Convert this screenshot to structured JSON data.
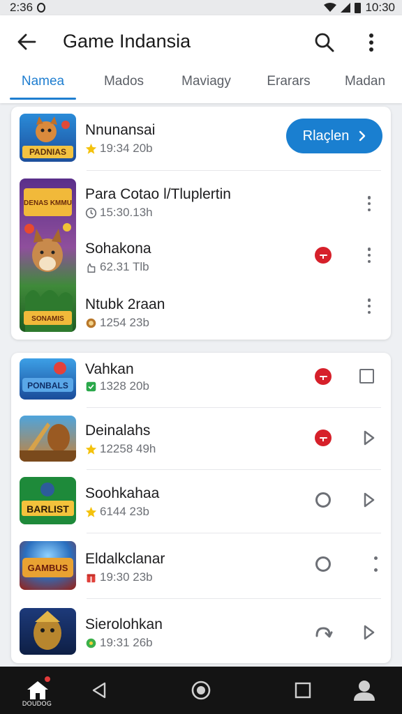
{
  "status_bar": {
    "time": "2:36",
    "clock": "10:30"
  },
  "app_bar": {
    "title": "Game Indansia"
  },
  "tabs": [
    {
      "label": "Namea",
      "active": true
    },
    {
      "label": "Mados",
      "active": false
    },
    {
      "label": "Maviagy",
      "active": false
    },
    {
      "label": "Erarars",
      "active": false
    },
    {
      "label": "Madan",
      "active": false
    }
  ],
  "card1": {
    "top_item": {
      "title": "Nnunansai",
      "meta": "19:34 20b",
      "thumb_text": "PADNIAS",
      "button_label": "Rlaçlen"
    },
    "group": {
      "thumb_top_text": "DENAS KMMU",
      "thumb_bottom_text": "SONAMIS",
      "items": [
        {
          "title": "Para Cotao l/Tluplertin",
          "meta": "15:30.13h"
        },
        {
          "title": "Sohakona",
          "meta": "62.31 Tlb"
        },
        {
          "title": "Ntubk 2raan",
          "meta": "1254 23b"
        }
      ]
    }
  },
  "card2": {
    "items": [
      {
        "title": "Vahkan",
        "meta": "1328 20b",
        "thumb_text": "PONBALS"
      },
      {
        "title": "Deinalahs",
        "meta": "12258 49h",
        "thumb_text": ""
      },
      {
        "title": "Soohkahaa",
        "meta": "6144 23b",
        "thumb_text": "BARLIST"
      },
      {
        "title": "Eldalkclanar",
        "meta": "19:30 23b",
        "thumb_text": "GAMBUS"
      },
      {
        "title": "Sierolohkan",
        "meta": "19:31 26b",
        "thumb_text": ""
      }
    ]
  },
  "nav": {
    "home_label": "DOUDOG"
  },
  "colors": {
    "accent": "#1f7ed0",
    "danger": "#d6202a",
    "nav_bg": "#141414"
  }
}
